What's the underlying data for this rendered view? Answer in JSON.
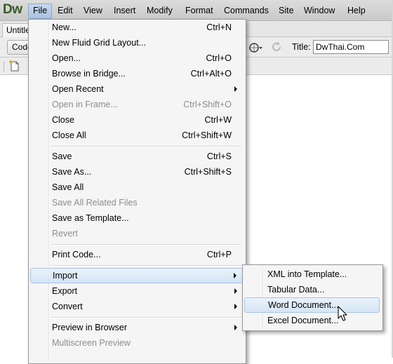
{
  "app": {
    "logo": "Dw",
    "document_tab": "Untitled",
    "code_button": "Code",
    "title_label": "Title:",
    "title_value": "DwThai.Com"
  },
  "menubar": [
    {
      "label": "File",
      "active": true
    },
    {
      "label": "Edit"
    },
    {
      "label": "View"
    },
    {
      "label": "Insert"
    },
    {
      "label": "Modify"
    },
    {
      "label": "Format"
    },
    {
      "label": "Commands"
    },
    {
      "label": "Site"
    },
    {
      "label": "Window"
    },
    {
      "label": "Help"
    }
  ],
  "file_menu": {
    "items": [
      {
        "label": "New...",
        "shortcut": "Ctrl+N"
      },
      {
        "label": "New Fluid Grid Layout...",
        "shortcut": ""
      },
      {
        "label": "Open...",
        "shortcut": "Ctrl+O"
      },
      {
        "label": "Browse in Bridge...",
        "shortcut": "Ctrl+Alt+O"
      },
      {
        "label": "Open Recent",
        "shortcut": "",
        "submenu": true
      },
      {
        "label": "Open in Frame...",
        "shortcut": "Ctrl+Shift+O",
        "disabled": true
      },
      {
        "label": "Close",
        "shortcut": "Ctrl+W"
      },
      {
        "label": "Close All",
        "shortcut": "Ctrl+Shift+W"
      },
      {
        "label": "Save",
        "shortcut": "Ctrl+S"
      },
      {
        "label": "Save As...",
        "shortcut": "Ctrl+Shift+S"
      },
      {
        "label": "Save All",
        "shortcut": ""
      },
      {
        "label": "Save All Related Files",
        "shortcut": "",
        "disabled": true
      },
      {
        "label": "Save as Template...",
        "shortcut": ""
      },
      {
        "label": "Revert",
        "shortcut": "",
        "disabled": true
      },
      {
        "label": "Print Code...",
        "shortcut": "Ctrl+P"
      },
      {
        "label": "Import",
        "shortcut": "",
        "submenu": true,
        "highlighted": true
      },
      {
        "label": "Export",
        "shortcut": "",
        "submenu": true
      },
      {
        "label": "Convert",
        "shortcut": "",
        "submenu": true
      },
      {
        "label": "Preview in Browser",
        "shortcut": "",
        "submenu": true
      },
      {
        "label": "Multiscreen Preview",
        "shortcut": "",
        "disabled": true
      }
    ]
  },
  "import_submenu": {
    "items": [
      {
        "label": "XML into Template..."
      },
      {
        "label": "Tabular Data..."
      },
      {
        "label": "Word Document...",
        "highlighted": true
      },
      {
        "label": "Excel Document..."
      }
    ]
  },
  "colors": {
    "menu_bg": "#f5f5f5",
    "highlight": "#d6e5f5",
    "disabled_text": "#8d8d8d",
    "logo": "#3a5a26"
  }
}
